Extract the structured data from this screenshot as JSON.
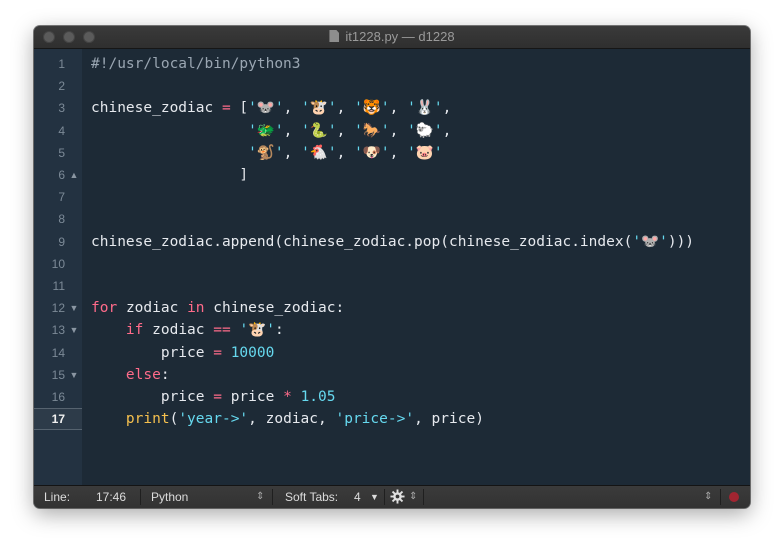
{
  "window": {
    "title": "it1228.py — d1228"
  },
  "editor": {
    "current_line": "17",
    "lines": [
      {
        "num": "1",
        "fold": "",
        "text": "#!/usr/local/bin/python3"
      },
      {
        "num": "2",
        "fold": "",
        "text": ""
      },
      {
        "num": "3",
        "fold": "",
        "text": "chinese_zodiac = ['🐭', '🐮', '🐯', '🐰',"
      },
      {
        "num": "4",
        "fold": "",
        "text": "                  '🐲', '🐍', '🐎', '🐑',"
      },
      {
        "num": "5",
        "fold": "",
        "text": "                  '🐒', '🐔', '🐶', '🐷'"
      },
      {
        "num": "6",
        "fold": "▲",
        "text": "                 ]"
      },
      {
        "num": "7",
        "fold": "",
        "text": ""
      },
      {
        "num": "8",
        "fold": "",
        "text": ""
      },
      {
        "num": "9",
        "fold": "",
        "text": "chinese_zodiac.append(chinese_zodiac.pop(chinese_zodiac.index('🐭')))"
      },
      {
        "num": "10",
        "fold": "",
        "text": ""
      },
      {
        "num": "11",
        "fold": "",
        "text": ""
      },
      {
        "num": "12",
        "fold": "▼",
        "text": "for zodiac in chinese_zodiac:"
      },
      {
        "num": "13",
        "fold": "▼",
        "text": "    if zodiac == '🐮':"
      },
      {
        "num": "14",
        "fold": "",
        "text": "        price = 10000"
      },
      {
        "num": "15",
        "fold": "▼",
        "text": "    else:"
      },
      {
        "num": "16",
        "fold": "",
        "text": "        price = price * 1.05"
      },
      {
        "num": "17",
        "fold": "",
        "text": "    print('year->', zodiac, 'price->', price)"
      }
    ]
  },
  "statusbar": {
    "line_label": "Line:",
    "position": "17:46",
    "language": "Python",
    "tabs_label": "Soft Tabs:",
    "tab_size": "4"
  },
  "colors": {
    "keyword": "#ff6b8a",
    "string": "#66d9ef",
    "function": "#f5c04e",
    "background": "#1d2a36"
  },
  "icons": [
    "file-icon",
    "gear-icon",
    "record-icon",
    "fold-up-icon",
    "fold-down-icon"
  ]
}
